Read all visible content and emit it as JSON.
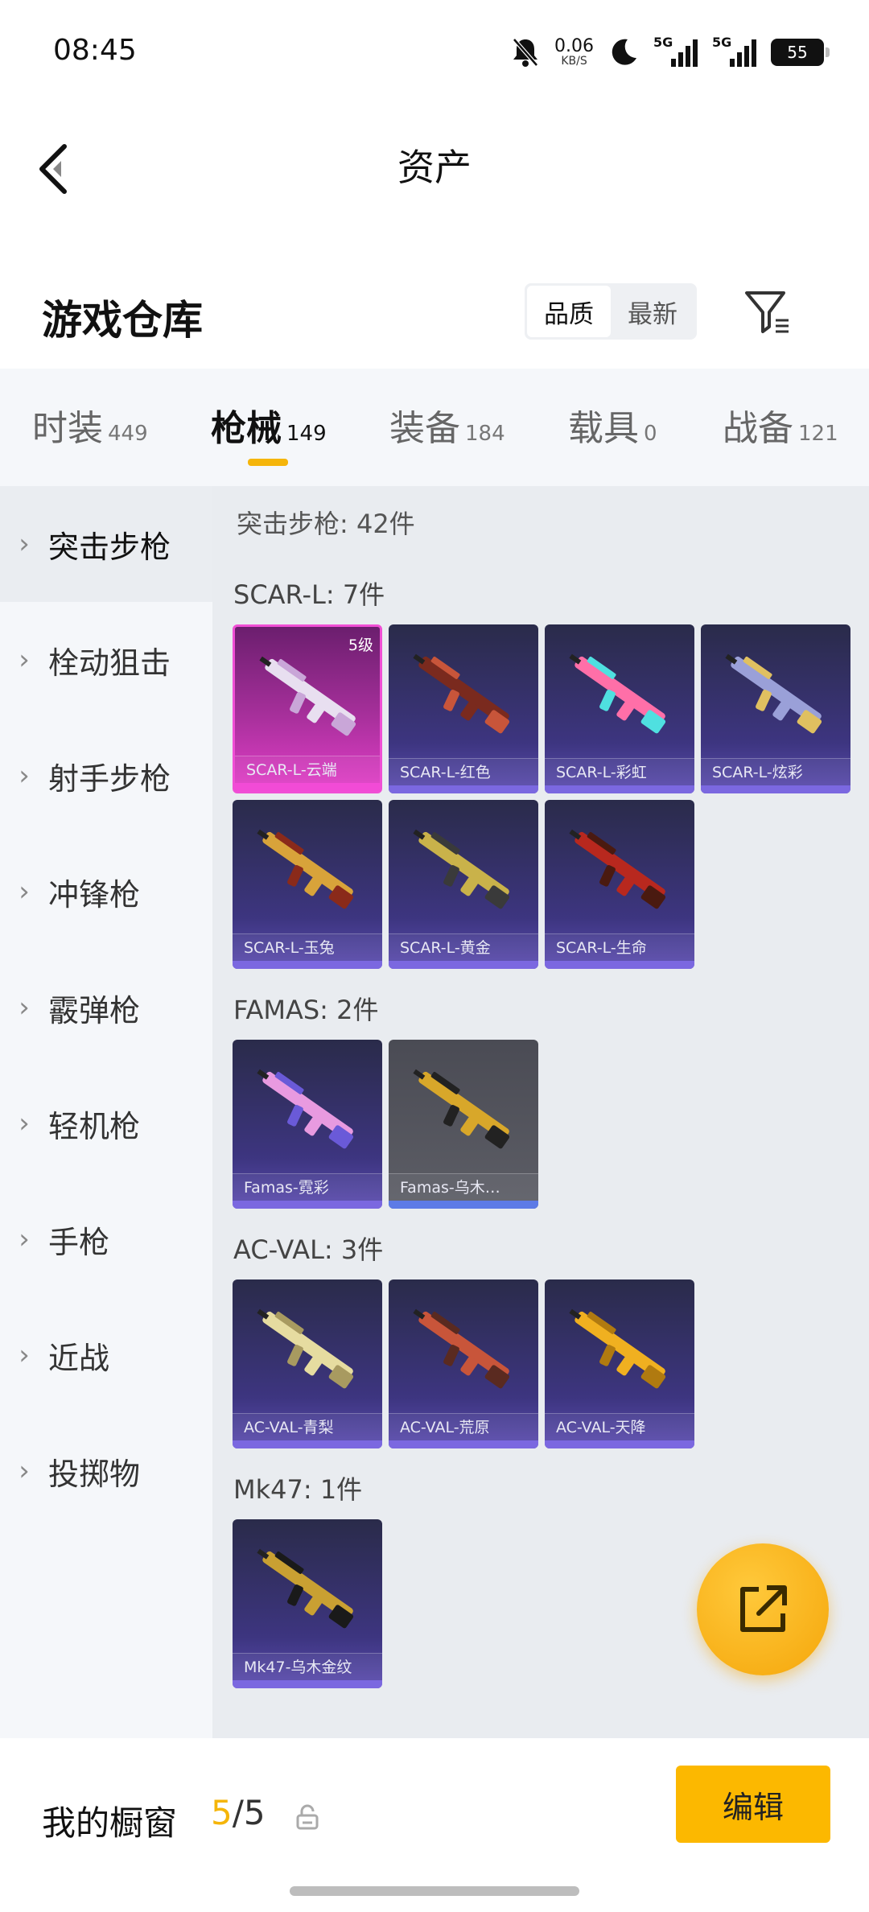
{
  "status_bar": {
    "time": "08:45",
    "speed_value": "0.06",
    "speed_unit": "KB/S",
    "net1": "5G",
    "net2": "5G",
    "battery": "55",
    "icons": [
      "mute-icon",
      "moon-icon",
      "signal-icon",
      "battery-icon"
    ]
  },
  "header": {
    "title": "资产",
    "back_icon": "back-arrow-icon"
  },
  "warehouse": {
    "title": "游戏仓库",
    "sort_options": [
      "品质",
      "最新"
    ],
    "sort_selected": "品质",
    "filter_icon": "filter-icon"
  },
  "tabs": [
    {
      "name": "时装",
      "count": "449"
    },
    {
      "name": "枪械",
      "count": "149"
    },
    {
      "name": "装备",
      "count": "184"
    },
    {
      "name": "载具",
      "count": "0"
    },
    {
      "name": "战备",
      "count": "121"
    }
  ],
  "active_tab": "枪械",
  "sidebar": {
    "items": [
      {
        "label": "突击步枪"
      },
      {
        "label": "栓动狙击"
      },
      {
        "label": "射手步枪"
      },
      {
        "label": "冲锋枪"
      },
      {
        "label": "霰弹枪"
      },
      {
        "label": "轻机枪"
      },
      {
        "label": "手枪"
      },
      {
        "label": "近战"
      },
      {
        "label": "投掷物"
      }
    ],
    "active": "突击步枪"
  },
  "content": {
    "summary": "突击步枪: 42件",
    "groups": [
      {
        "title": "SCAR-L: 7件",
        "items": [
          {
            "name": "SCAR-L-云端",
            "level": "5级",
            "style": "pink"
          },
          {
            "name": "SCAR-L-红色",
            "style": "purple"
          },
          {
            "name": "SCAR-L-彩虹",
            "style": "purple"
          },
          {
            "name": "SCAR-L-炫彩",
            "style": "purple"
          },
          {
            "name": "SCAR-L-玉兔",
            "style": "purple"
          },
          {
            "name": "SCAR-L-黄金",
            "style": "purple"
          },
          {
            "name": "SCAR-L-生命",
            "style": "purple"
          }
        ]
      },
      {
        "title": "FAMAS: 2件",
        "items": [
          {
            "name": "Famas-霓彩",
            "style": "purple"
          },
          {
            "name": "Famas-乌木…",
            "style": "gray"
          }
        ]
      },
      {
        "title": "AC-VAL: 3件",
        "items": [
          {
            "name": "AC-VAL-青梨",
            "style": "purple"
          },
          {
            "name": "AC-VAL-荒原",
            "style": "purple"
          },
          {
            "name": "AC-VAL-天降",
            "style": "purple"
          }
        ]
      },
      {
        "title": "Mk47: 1件",
        "items": [
          {
            "name": "Mk47-乌木金纹",
            "style": "purple"
          }
        ]
      }
    ]
  },
  "fab": {
    "icon": "share-icon"
  },
  "bottom_bar": {
    "label": "我的橱窗",
    "count_current": "5",
    "count_total": "/5",
    "lock_icon": "lock-icon",
    "edit_label": "编辑"
  },
  "colors": {
    "accent": "#fcb800",
    "tab_indicator": "#f5b50a"
  }
}
